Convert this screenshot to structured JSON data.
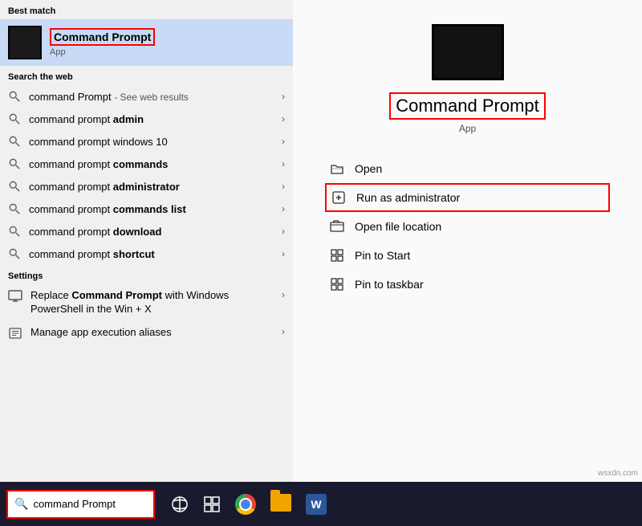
{
  "left": {
    "best_match_header": "Best match",
    "best_match_title": "Command Prompt",
    "best_match_subtitle": "App",
    "search_web_header": "Search the web",
    "search_items": [
      {
        "text": "command Prompt",
        "suffix": "- See web results",
        "bold": false
      },
      {
        "text": "command prompt ",
        "bold_part": "admin",
        "suffix": ""
      },
      {
        "text": "command prompt windows 10",
        "bold": false,
        "suffix": ""
      },
      {
        "text": "command prompt ",
        "bold_part": "commands",
        "suffix": ""
      },
      {
        "text": "command prompt ",
        "bold_part": "administrator",
        "suffix": ""
      },
      {
        "text": "command prompt ",
        "bold_part": "commands list",
        "suffix": ""
      },
      {
        "text": "command prompt ",
        "bold_part": "download",
        "suffix": ""
      },
      {
        "text": "command prompt ",
        "bold_part": "shortcut",
        "suffix": ""
      }
    ],
    "settings_header": "Settings",
    "settings_items": [
      {
        "text": "Replace Command Prompt with Windows PowerShell in the Win + X"
      },
      {
        "text": "Manage app execution aliases"
      }
    ]
  },
  "right": {
    "app_title": "Command Prompt",
    "app_type": "App",
    "actions": [
      {
        "label": "Open",
        "icon": "open-icon"
      },
      {
        "label": "Run as administrator",
        "icon": "run-admin-icon",
        "highlighted": true
      },
      {
        "label": "Open file location",
        "icon": "file-location-icon"
      },
      {
        "label": "Pin to Start",
        "icon": "pin-start-icon"
      },
      {
        "label": "Pin to taskbar",
        "icon": "pin-taskbar-icon"
      }
    ]
  },
  "taskbar": {
    "search_placeholder": "command Prompt",
    "icons": [
      "search",
      "task-view",
      "chrome",
      "files",
      "word"
    ]
  },
  "watermark": "wsxdn.com"
}
